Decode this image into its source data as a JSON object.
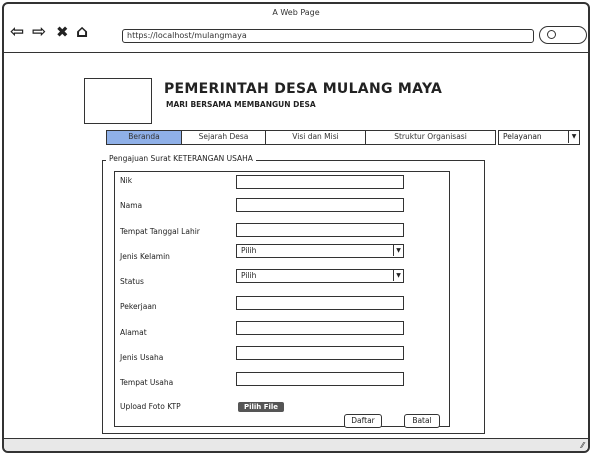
{
  "window": {
    "title": "A Web Page"
  },
  "browser": {
    "url": "https://localhost/mulangmaya",
    "icons": [
      "back-arrow-icon",
      "forward-arrow-icon",
      "close-icon",
      "home-icon",
      "search-icon"
    ]
  },
  "header": {
    "title": "PEMERINTAH DESA MULANG MAYA",
    "subtitle": "MARI BERSAMA MEMBANGUN DESA"
  },
  "nav": {
    "tabs": [
      {
        "label": "Beranda",
        "active": true
      },
      {
        "label": "Sejarah Desa",
        "active": false
      },
      {
        "label": "Visi dan Misi",
        "active": false
      },
      {
        "label": "Struktur Organisasi",
        "active": false
      }
    ],
    "dropdown": {
      "label": "Pelayanan"
    }
  },
  "form": {
    "legend": "Pengajuan Surat KETERANGAN USAHA",
    "fields": [
      {
        "label": "Nik",
        "type": "text",
        "value": ""
      },
      {
        "label": "Nama",
        "type": "text",
        "value": ""
      },
      {
        "label": "Tempat Tanggal Lahir",
        "type": "text",
        "value": ""
      },
      {
        "label": "Jenis Kelamin",
        "type": "select",
        "value": "Pilih"
      },
      {
        "label": "Status",
        "type": "select",
        "value": "Pilih"
      },
      {
        "label": "Pekerjaan",
        "type": "text",
        "value": ""
      },
      {
        "label": "Alamat",
        "type": "text",
        "value": ""
      },
      {
        "label": "Jenis Usaha",
        "type": "text",
        "value": ""
      },
      {
        "label": "Tempat Usaha",
        "type": "text",
        "value": ""
      }
    ],
    "upload": {
      "label": "Upload Foto KTP",
      "button": "Pilih File"
    },
    "submit_label": "Daftar",
    "cancel_label": "Batal"
  },
  "colors": {
    "active_tab": "#8fb0e8",
    "file_button": "#555555"
  }
}
